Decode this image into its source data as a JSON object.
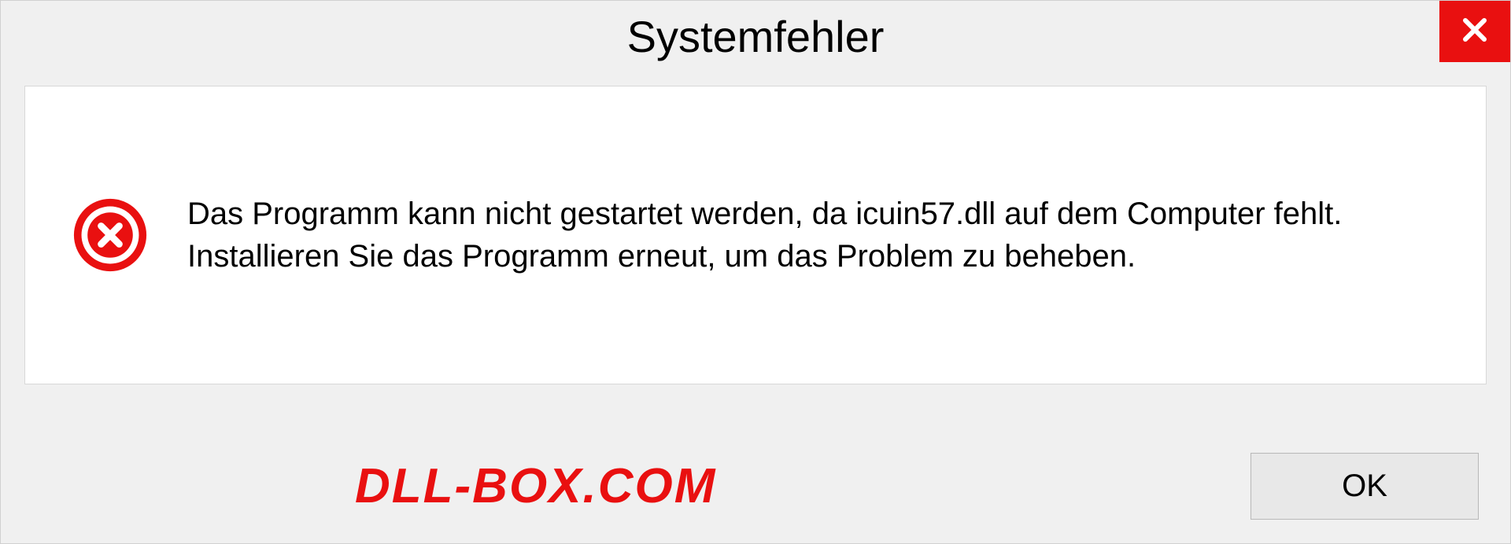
{
  "dialog": {
    "title": "Systemfehler",
    "message": "Das Programm kann nicht gestartet werden, da icuin57.dll auf dem Computer fehlt. Installieren Sie das Programm erneut, um das Problem zu beheben.",
    "ok_label": "OK"
  },
  "watermark": "DLL-BOX.COM",
  "colors": {
    "accent": "#e91010",
    "background": "#f0f0f0",
    "content_bg": "#ffffff"
  }
}
